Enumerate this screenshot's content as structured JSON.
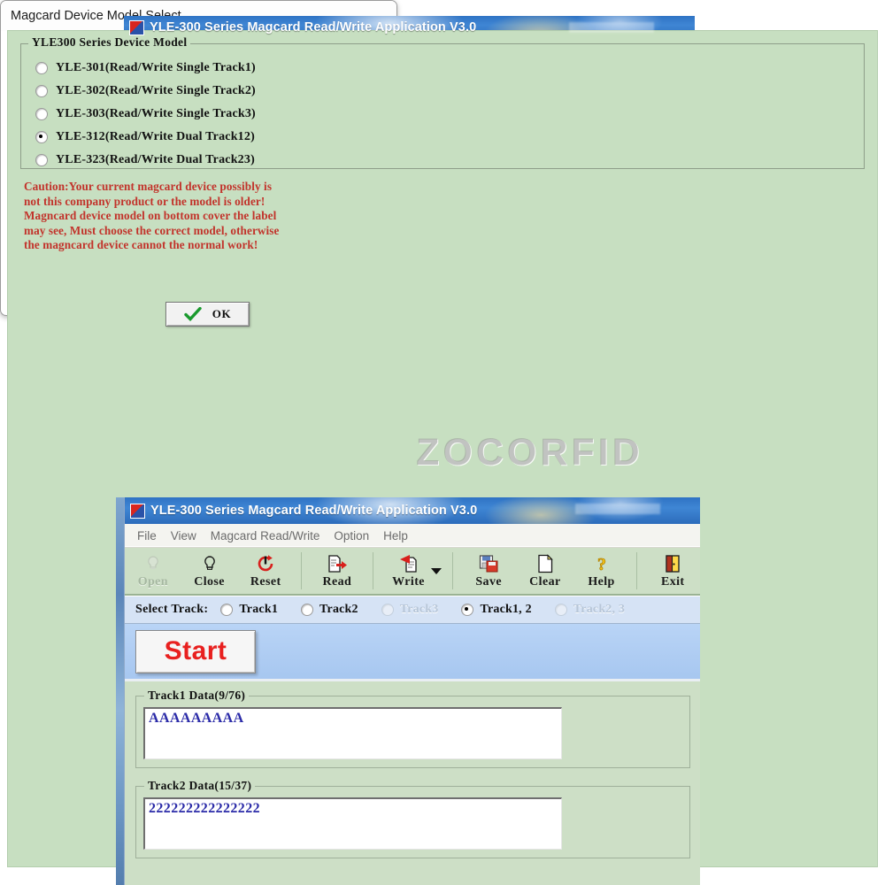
{
  "app": {
    "title": "YLE-300 Series Magcard Read/Write Application V3.0",
    "menu": [
      "File",
      "View",
      "Magcard Read/Write",
      "Option",
      "Help"
    ],
    "menu_top": [
      "ile",
      "View",
      "Magcard Read/Write",
      "Option",
      "Help"
    ],
    "toolbar": [
      {
        "label": "Open",
        "icon": "bulb-icon"
      },
      {
        "label": "Close",
        "icon": "bulb-off-icon"
      },
      {
        "label": "Reset",
        "icon": "reset-circle-icon"
      },
      {
        "label": "Read",
        "icon": "read-arrow-icon"
      },
      {
        "label": "Write",
        "icon": "write-arrow-icon"
      },
      {
        "label": "Save",
        "icon": "save-disk-icon"
      },
      {
        "label": "Clear",
        "icon": "blank-page-icon"
      },
      {
        "label": "Help",
        "icon": "question-mark-icon"
      },
      {
        "label": "Exit",
        "icon": "exit-door-icon"
      }
    ]
  },
  "top_window": {
    "enabled_buttons": [
      "Open",
      "Save",
      "Clear",
      "Help",
      "Exit"
    ],
    "disabled_buttons": [
      "Close",
      "Reset",
      "Read",
      "Write"
    ]
  },
  "bottom_window": {
    "enabled_buttons": [
      "Close",
      "Reset",
      "Read",
      "Write",
      "Save",
      "Clear",
      "Help",
      "Exit"
    ],
    "disabled_buttons": [
      "Open"
    ],
    "select_track_label": "Select Track:",
    "track_options": [
      {
        "label": "Track1",
        "selected": false,
        "disabled": false,
        "underline": "1"
      },
      {
        "label": "Track2",
        "selected": false,
        "disabled": false,
        "underline": "2"
      },
      {
        "label": "Track3",
        "selected": false,
        "disabled": true,
        "underline": "3"
      },
      {
        "label": "Track1, 2",
        "selected": true,
        "disabled": false,
        "underline": ""
      },
      {
        "label": "Track2, 3",
        "selected": false,
        "disabled": true,
        "underline": ""
      }
    ],
    "start_button": "Start",
    "track1": {
      "group_title": "Track1 Data(9/76)",
      "value": "AAAAAAAAA"
    },
    "track2": {
      "group_title": "Track2 Data(15/37)",
      "value": "222222222222222"
    }
  },
  "dialog": {
    "title": "Magcard Device Model Select",
    "group_title": "YLE300 Series Device Model",
    "models": [
      {
        "label": "YLE-301(Read/Write Single Track1)",
        "selected": false
      },
      {
        "label": "YLE-302(Read/Write Single Track2)",
        "selected": false
      },
      {
        "label": "YLE-303(Read/Write Single Track3)",
        "selected": false
      },
      {
        "label": "YLE-312(Read/Write Dual Track12)",
        "selected": true
      },
      {
        "label": "YLE-323(Read/Write Dual Track23)",
        "selected": false
      }
    ],
    "caution": "Caution:Your current magcard device possibly is\nnot this company product or the model is older!\nMagncard device model on bottom cover the label\nmay see, Must choose the correct model, otherwise\nthe magncard device cannot the normal work!",
    "caution_color": "#c2332b",
    "ok_button": "OK"
  },
  "watermark": "ZOCORFID",
  "colors": {
    "toolbar_green": "#cddfc6",
    "dialog_green": "#c7dfc1",
    "titlebar_blue": "#2f73c4",
    "track_bar_blue": "#d6e3f5",
    "start_pane_blue": "#a9c9f2",
    "data_text_blue": "#2b2ba8",
    "start_text_red": "#e8201f"
  }
}
